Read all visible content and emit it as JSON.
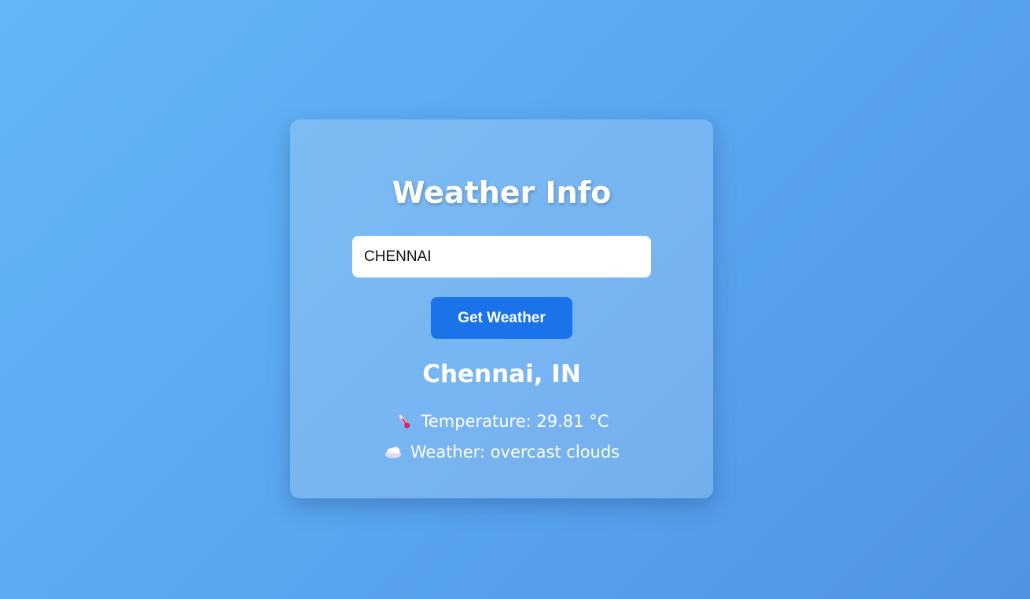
{
  "card": {
    "title": "Weather Info",
    "input": {
      "value": "CHENNAI",
      "placeholder": ""
    },
    "button_label": "Get Weather",
    "location": "Chennai, IN",
    "temperature_text": "Temperature: 29.81 °C",
    "weather_text": "Weather: overcast clouds",
    "temperature_icon": "thermometer-icon",
    "weather_icon": "cloud-icon"
  },
  "colors": {
    "background_start": "#64b6f7",
    "background_end": "#4f94e4",
    "button": "#1a73e8",
    "text": "#ffffff"
  }
}
